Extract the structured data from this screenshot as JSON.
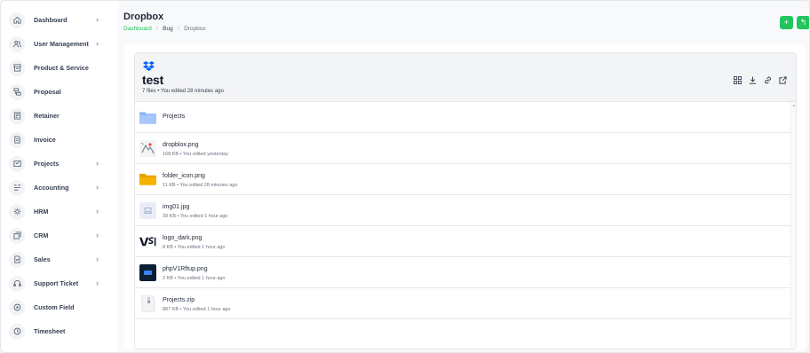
{
  "sidebar": {
    "items": [
      {
        "label": "Dashboard",
        "icon": "home-icon",
        "has_submenu": true
      },
      {
        "label": "User Management",
        "icon": "users-icon",
        "has_submenu": true
      },
      {
        "label": "Product & Service",
        "icon": "box-icon",
        "has_submenu": false
      },
      {
        "label": "Proposal",
        "icon": "proposal-icon",
        "has_submenu": false
      },
      {
        "label": "Retainer",
        "icon": "retainer-icon",
        "has_submenu": false
      },
      {
        "label": "Invoice",
        "icon": "invoice-icon",
        "has_submenu": false
      },
      {
        "label": "Projects",
        "icon": "projects-icon",
        "has_submenu": true
      },
      {
        "label": "Accounting",
        "icon": "accounting-icon",
        "has_submenu": true
      },
      {
        "label": "HRM",
        "icon": "hrm-icon",
        "has_submenu": true
      },
      {
        "label": "CRM",
        "icon": "crm-icon",
        "has_submenu": true
      },
      {
        "label": "Sales",
        "icon": "sales-icon",
        "has_submenu": true
      },
      {
        "label": "Support Ticket",
        "icon": "headset-icon",
        "has_submenu": true
      },
      {
        "label": "Custom Field",
        "icon": "custom-field-icon",
        "has_submenu": false
      },
      {
        "label": "Timesheet",
        "icon": "clock-icon",
        "has_submenu": false
      }
    ],
    "chevron": "›"
  },
  "header": {
    "title": "Dropbox",
    "breadcrumb": [
      "Dashboard",
      "Bug",
      "Dropbox"
    ],
    "breadcrumb_sep": "›",
    "buttons": [
      {
        "label": "+",
        "icon": "plus-icon"
      },
      {
        "label": "↰",
        "icon": "back-icon"
      }
    ]
  },
  "dropbox": {
    "folder_name": "test",
    "meta": "7 files • You edited 28 minutes ago",
    "actions": [
      "grid-icon",
      "download-icon",
      "link-icon",
      "external-link-icon"
    ],
    "files": [
      {
        "name": "Projects",
        "info": "",
        "type": "folder-blue"
      },
      {
        "name": "dropblox.png",
        "info": "168 KB • You edited yesterday",
        "type": "image-sketch"
      },
      {
        "name": "folder_icon.png",
        "info": "11 KB • You edited 28 minutes ago",
        "type": "folder-yellow"
      },
      {
        "name": "img01.jpg",
        "info": "39 KB • You edited 1 hour ago",
        "type": "image-placeholder"
      },
      {
        "name": "logo_dark.png",
        "info": "8 KB • You edited 1 hour ago",
        "type": "logo-dark"
      },
      {
        "name": "phpV1Rftup.png",
        "info": "2 KB • You edited 1 hour ago",
        "type": "app-icon"
      },
      {
        "name": "Projects.zip",
        "info": "887 KB • You edited 1 hour ago",
        "type": "zip"
      }
    ]
  },
  "colors": {
    "accent": "#22c55e",
    "dropbox_blue": "#0061fe",
    "folder_blue": "#8ab4f8",
    "folder_yellow": "#f5b200"
  }
}
